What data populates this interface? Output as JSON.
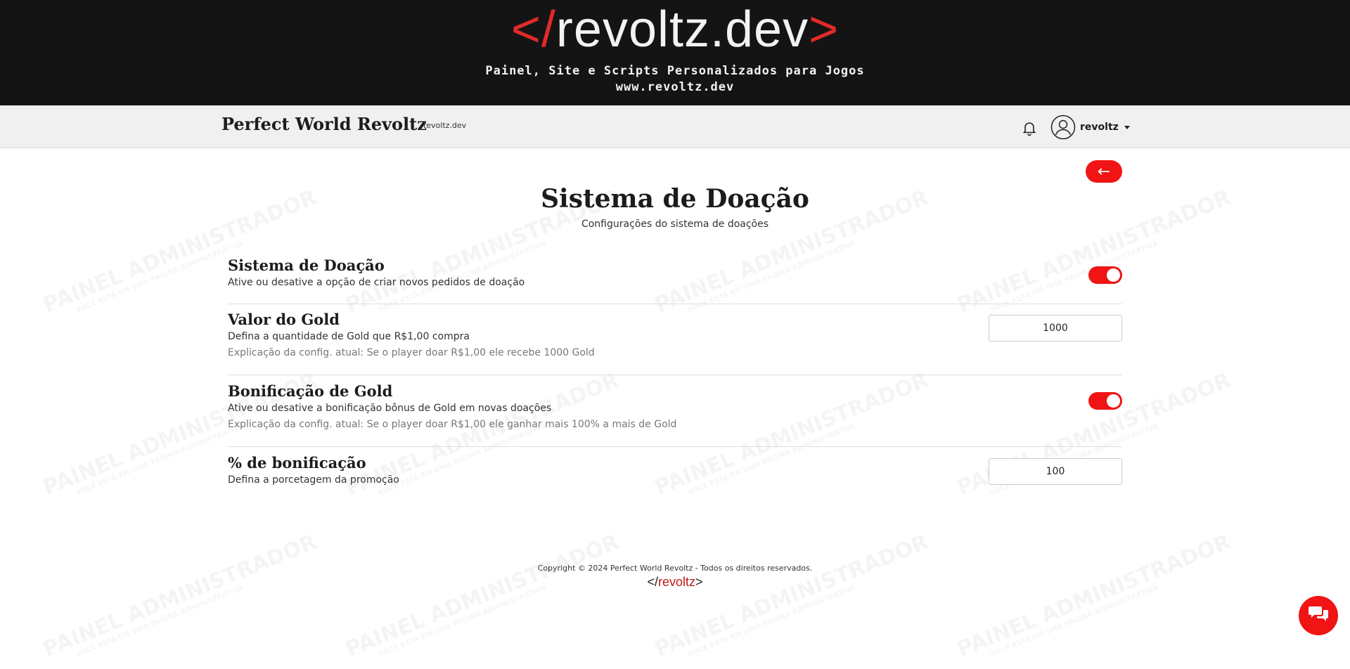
{
  "banner": {
    "logo_open": "</",
    "logo_text": "revoltz.dev",
    "logo_close": ">",
    "tagline": "Painel, Site e Scripts Personalizados para Jogos",
    "url": "www.revoltz.dev"
  },
  "navbar": {
    "brand": "Perfect World Revoltz",
    "brand_small": "revoltz.dev",
    "bell_icon": "bell-icon",
    "avatar_icon": "user-circle-icon",
    "username": "revoltz"
  },
  "page": {
    "back_label": "←",
    "title": "Sistema de Doação",
    "subtitle": "Configurações do sistema de doações"
  },
  "settings": [
    {
      "title": "Sistema de Doação",
      "desc": "Ative ou desative a opção de criar novos pedidos de doação",
      "control": "toggle",
      "enabled": true
    },
    {
      "title": "Valor do Gold",
      "desc": "Defina a quantidade de Gold que R$1,00 compra",
      "expl": "Explicação da config. atual: Se o player doar R$1,00 ele recebe 1000 Gold",
      "control": "input",
      "value": "1000"
    },
    {
      "title": "Bonificação de Gold",
      "desc": "Ative ou desative a bonificação bônus de Gold em novas doações",
      "expl": "Explicação da config. atual: Se o player doar R$1,00 ele ganhar mais 100% a mais de Gold",
      "control": "toggle",
      "enabled": true
    },
    {
      "title": "% de bonificação",
      "desc": "Defina a porcetagem da promoção",
      "control": "input",
      "value": "100"
    }
  ],
  "footer": {
    "copyright": "Copyright © 2024 Perfect World Revoltz - Todos os direitos reservados.",
    "logo_open": "</",
    "logo_text": "revoltz",
    "logo_close": ">"
  },
  "watermark": {
    "main": "PAINEL ADMINISTRADOR",
    "small": "VOCÊ ESTÁ EM UMA PÁGINA ADMINISTRATIVA"
  },
  "colors": {
    "accent": "#f01414",
    "banner_bg": "#141414",
    "navbar_bg": "#f0f0f0"
  },
  "chat_icon": "chat-bubbles-icon"
}
